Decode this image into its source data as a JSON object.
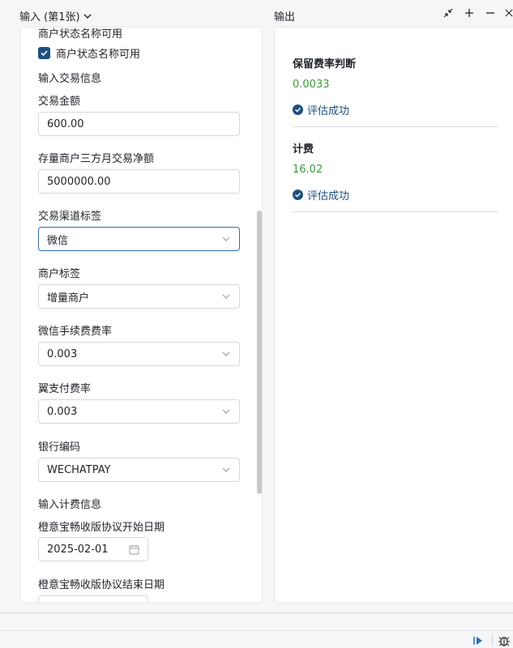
{
  "header": {
    "input_title": "输入 (第1张)",
    "output_title": "输出"
  },
  "input_panel": {
    "cut_section_title": "商户状态名称可用",
    "checkbox_label": "商户状态名称可用",
    "checkbox_checked": true,
    "section_trade": "输入交易信息",
    "fields": {
      "amount_label": "交易金额",
      "amount_value": "600.00",
      "net_label": "存量商户三方月交易净额",
      "net_value": "5000000.00",
      "channel_label": "交易渠道标签",
      "channel_value": "微信",
      "merchant_label": "商户标签",
      "merchant_value": "增量商户",
      "wechat_rate_label": "微信手续费费率",
      "wechat_rate_value": "0.003",
      "yipay_rate_label": "翼支付费率",
      "yipay_rate_value": "0.003",
      "bank_code_label": "银行编码",
      "bank_code_value": "WECHATPAY"
    },
    "section_billing": "输入计费信息",
    "start_date_label": "橙意宝畅收版协议开始日期",
    "start_date_value": "2025-02-01",
    "end_date_label": "橙意宝畅收版协议结束日期"
  },
  "output_panel": {
    "results": [
      {
        "title": "保留费率判断",
        "value": "0.0033",
        "status": "评估成功"
      },
      {
        "title": "计费",
        "value": "16.02",
        "status": "评估成功"
      }
    ]
  },
  "colors": {
    "accent": "#1e4f7c",
    "success_value": "#3a9a3a",
    "focus_border": "#2b6cb0"
  },
  "icons": [
    "chevron-down-icon",
    "collapse-icon",
    "plus-icon",
    "minus-icon",
    "close-icon",
    "check-icon",
    "calendar-icon",
    "play-step-icon",
    "bug-icon"
  ]
}
